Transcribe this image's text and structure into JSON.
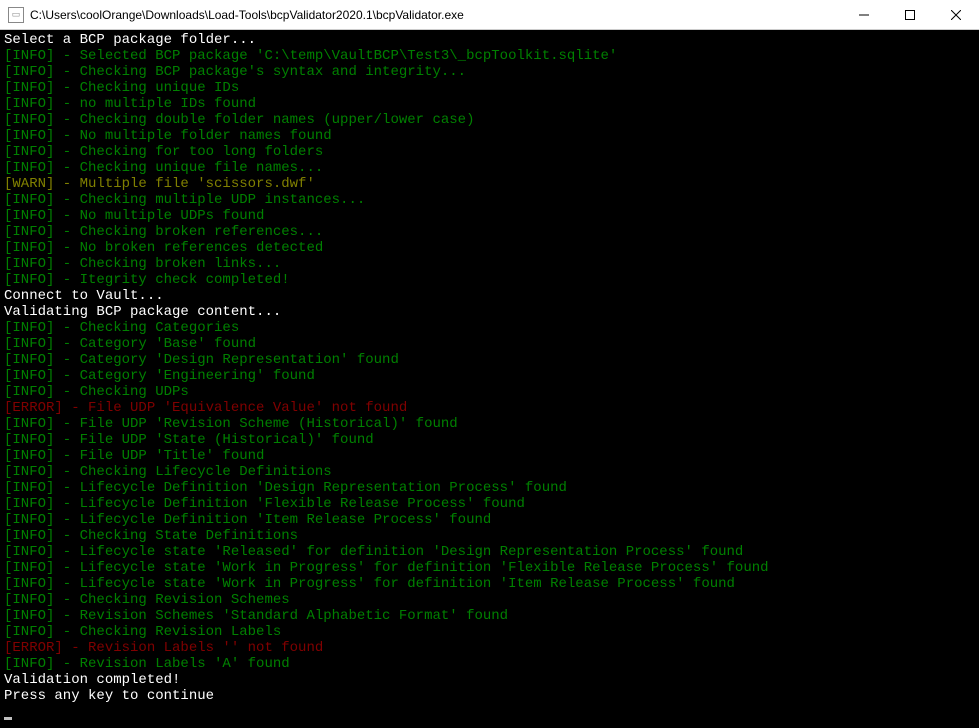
{
  "titlebar": {
    "path": "C:\\Users\\coolOrange\\Downloads\\Load-Tools\\bcpValidator2020.1\\bcpValidator.exe"
  },
  "lines": [
    {
      "level": "white",
      "text": "Select a BCP package folder..."
    },
    {
      "level": "info",
      "text": "Selected BCP package 'C:\\temp\\VaultBCP\\Test3\\_bcpToolkit.sqlite'"
    },
    {
      "level": "info",
      "text": "Checking BCP package's syntax and integrity..."
    },
    {
      "level": "info",
      "text": "Checking unique IDs"
    },
    {
      "level": "info",
      "text": "no multiple IDs found"
    },
    {
      "level": "info",
      "text": "Checking double folder names (upper/lower case)"
    },
    {
      "level": "info",
      "text": "No multiple folder names found"
    },
    {
      "level": "info",
      "text": "Checking for too long folders"
    },
    {
      "level": "info",
      "text": "Checking unique file names..."
    },
    {
      "level": "warn",
      "text": "Multiple file 'scissors.dwf'"
    },
    {
      "level": "info",
      "text": "Checking multiple UDP instances..."
    },
    {
      "level": "info",
      "text": "No multiple UDPs found"
    },
    {
      "level": "info",
      "text": "Checking broken references..."
    },
    {
      "level": "info",
      "text": "No broken references detected"
    },
    {
      "level": "info",
      "text": "Checking broken links..."
    },
    {
      "level": "info",
      "text": "Itegrity check completed!"
    },
    {
      "level": "white",
      "text": "Connect to Vault..."
    },
    {
      "level": "white",
      "text": "Validating BCP package content..."
    },
    {
      "level": "info",
      "text": "Checking Categories"
    },
    {
      "level": "info",
      "text": "Category 'Base' found"
    },
    {
      "level": "info",
      "text": "Category 'Design Representation' found"
    },
    {
      "level": "info",
      "text": "Category 'Engineering' found"
    },
    {
      "level": "info",
      "text": "Checking UDPs"
    },
    {
      "level": "error",
      "text": "File UDP 'Equivalence Value' not found"
    },
    {
      "level": "info",
      "text": "File UDP 'Revision Scheme (Historical)' found"
    },
    {
      "level": "info",
      "text": "File UDP 'State (Historical)' found"
    },
    {
      "level": "info",
      "text": "File UDP 'Title' found"
    },
    {
      "level": "info",
      "text": "Checking Lifecycle Definitions"
    },
    {
      "level": "info",
      "text": "Lifecycle Definition 'Design Representation Process' found"
    },
    {
      "level": "info",
      "text": "Lifecycle Definition 'Flexible Release Process' found"
    },
    {
      "level": "info",
      "text": "Lifecycle Definition 'Item Release Process' found"
    },
    {
      "level": "info",
      "text": "Checking State Definitions"
    },
    {
      "level": "info",
      "text": "Lifecycle state 'Released' for definition 'Design Representation Process' found"
    },
    {
      "level": "info",
      "text": "Lifecycle state 'Work in Progress' for definition 'Flexible Release Process' found"
    },
    {
      "level": "info",
      "text": "Lifecycle state 'Work in Progress' for definition 'Item Release Process' found"
    },
    {
      "level": "info",
      "text": "Checking Revision Schemes"
    },
    {
      "level": "info",
      "text": "Revision Schemes 'Standard Alphabetic Format' found"
    },
    {
      "level": "info",
      "text": "Checking Revision Labels"
    },
    {
      "level": "error",
      "text": "Revision Labels '' not found"
    },
    {
      "level": "info",
      "text": "Revision Labels 'A' found"
    },
    {
      "level": "white",
      "text": "Validation completed!"
    },
    {
      "level": "white",
      "text": "Press any key to continue"
    }
  ],
  "labels": {
    "info": "INFO",
    "warn": "WARN",
    "error": "ERROR"
  }
}
